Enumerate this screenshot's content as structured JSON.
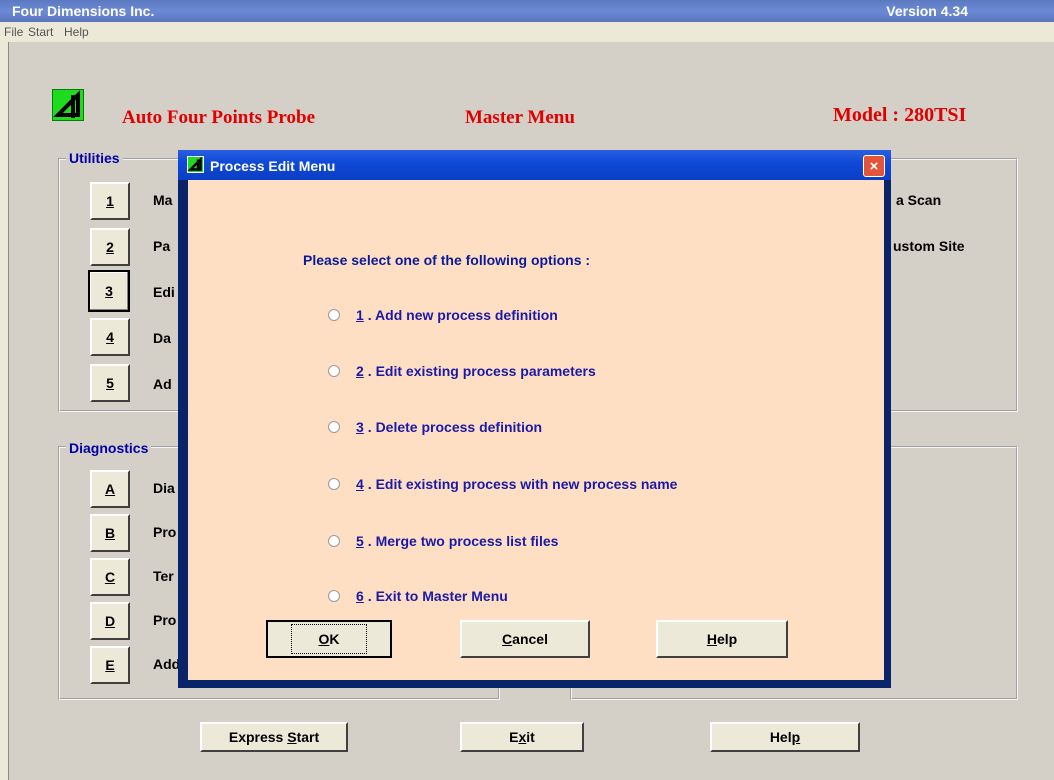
{
  "window": {
    "title": "Four Dimensions Inc.",
    "version": "Version 4.34"
  },
  "menu": [
    "File",
    "Start",
    "Help"
  ],
  "header": {
    "left": "Auto Four Points Probe",
    "center": "Master Menu",
    "right": "Model : 280TSI"
  },
  "utilities": {
    "label": "Utilities",
    "buttons": [
      "1",
      "2",
      "3",
      "4",
      "5"
    ],
    "texts": [
      "Ma",
      "Pa",
      "Edi",
      "Da",
      "Ad"
    ],
    "right_texts": [
      "a Scan",
      "ustom Site"
    ]
  },
  "diagnostics": {
    "label": "Diagnostics",
    "buttons": [
      "A",
      "B",
      "C",
      "D",
      "E"
    ],
    "texts": [
      "Dia",
      "Pro",
      "Ter",
      "Pro",
      "Add"
    ]
  },
  "dialog": {
    "title": "Process Edit Menu",
    "close": "×",
    "prompt": "Please select one of the following options :",
    "options": [
      {
        "num": "1",
        "text": ". Add new process definition"
      },
      {
        "num": "2",
        "text": ". Edit existing process parameters"
      },
      {
        "num": "3",
        "text": ". Delete process definition"
      },
      {
        "num": "4",
        "text": ". Edit existing process with new process name"
      },
      {
        "num": "5",
        "text": ". Merge two process list files"
      },
      {
        "num": "6",
        "text": ". Exit to Master Menu"
      }
    ],
    "ok": {
      "u": "O",
      "rest": "K"
    },
    "cancel": {
      "u": "C",
      "rest": "ancel"
    },
    "help": {
      "u": "H",
      "rest": "elp"
    }
  },
  "bottom": {
    "express": {
      "pre": "Express ",
      "u": "S",
      "post": "tart"
    },
    "exit": {
      "pre": "E",
      "u": "x",
      "post": "it"
    },
    "help": {
      "pre": "Hel",
      "u": "p",
      "post": ""
    }
  },
  "colors": {
    "accent_red": "#E00000",
    "title_blue": "#0A246A",
    "dialog_bg": "#FFDFC4"
  }
}
